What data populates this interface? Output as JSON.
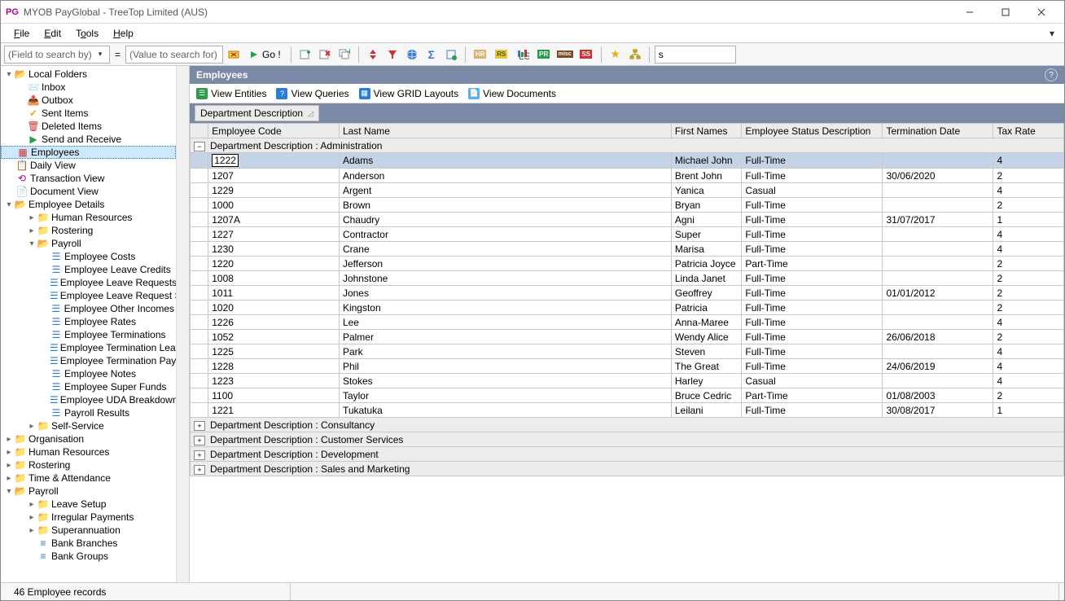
{
  "window": {
    "title": "MYOB PayGlobal - TreeTop Limited (AUS)",
    "logo": "PG"
  },
  "menu": {
    "file": "File",
    "edit": "Edit",
    "tools": "Tools",
    "help": "Help"
  },
  "toolbar": {
    "search_field_placeholder": "(Field to search by)",
    "search_value_placeholder": "(Value to search for)",
    "go_label": "Go !",
    "right_search_value": "s"
  },
  "sidebar": {
    "local_folders": {
      "label": "Local Folders",
      "inbox": "Inbox",
      "outbox": "Outbox",
      "sent": "Sent Items",
      "deleted": "Deleted Items",
      "sendrecv": "Send and Receive"
    },
    "employees": "Employees",
    "daily_view": "Daily View",
    "transaction_view": "Transaction View",
    "document_view": "Document View",
    "employee_details": {
      "label": "Employee Details",
      "hr": "Human Resources",
      "rostering": "Rostering",
      "payroll": {
        "label": "Payroll",
        "items": [
          "Employee Costs",
          "Employee Leave Credits",
          "Employee Leave Requests",
          "Employee Leave Request S",
          "Employee Other Incomes",
          "Employee Rates",
          "Employee Terminations",
          "Employee Termination Leave",
          "Employee Termination Paym",
          "Employee Notes",
          "Employee Super Funds",
          "Employee UDA Breakdowns",
          "Payroll Results"
        ]
      },
      "self_service": "Self-Service"
    },
    "organisation": "Organisation",
    "human_resources": "Human Resources",
    "rostering": "Rostering",
    "time_attendance": "Time & Attendance",
    "payroll_section": {
      "label": "Payroll",
      "items": [
        "Leave Setup",
        "Irregular Payments",
        "Superannuation",
        "Bank Branches",
        "Bank Groups"
      ]
    }
  },
  "main": {
    "title": "Employees",
    "views": {
      "entities": "View Entities",
      "queries": "View Queries",
      "grids": "View GRID Layouts",
      "docs": "View Documents"
    },
    "group_by": "Department Description",
    "columns": [
      "Employee Code",
      "Last Name",
      "First Names",
      "Employee Status Description",
      "Termination Date",
      "Tax Rate"
    ],
    "group_header_expanded": "Department Description : Administration",
    "rows": [
      {
        "code": "1222",
        "last": "Adams",
        "first": "Michael John",
        "status": "Full-Time",
        "term": "",
        "rate": "4",
        "selected": true
      },
      {
        "code": "1207",
        "last": "Anderson",
        "first": "Brent John",
        "status": "Full-Time",
        "term": "30/06/2020",
        "rate": "2"
      },
      {
        "code": "1229",
        "last": "Argent",
        "first": "Yanica",
        "status": "Casual",
        "term": "",
        "rate": "4"
      },
      {
        "code": "1000",
        "last": "Brown",
        "first": "Bryan",
        "status": "Full-Time",
        "term": "",
        "rate": "2"
      },
      {
        "code": "1207A",
        "last": "Chaudry",
        "first": "Agni",
        "status": "Full-Time",
        "term": "31/07/2017",
        "rate": "1"
      },
      {
        "code": "1227",
        "last": "Contractor",
        "first": "Super",
        "status": "Full-Time",
        "term": "",
        "rate": "4"
      },
      {
        "code": "1230",
        "last": "Crane",
        "first": "Marisa",
        "status": "Full-Time",
        "term": "",
        "rate": "4"
      },
      {
        "code": "1220",
        "last": "Jefferson",
        "first": "Patricia Joyce",
        "status": "Part-Time",
        "term": "",
        "rate": "2"
      },
      {
        "code": "1008",
        "last": "Johnstone",
        "first": "Linda Janet",
        "status": "Full-Time",
        "term": "",
        "rate": "2"
      },
      {
        "code": "1011",
        "last": "Jones",
        "first": "Geoffrey",
        "status": "Full-Time",
        "term": "01/01/2012",
        "rate": "2"
      },
      {
        "code": "1020",
        "last": "Kingston",
        "first": "Patricia",
        "status": "Full-Time",
        "term": "",
        "rate": "2"
      },
      {
        "code": "1226",
        "last": "Lee",
        "first": "Anna-Maree",
        "status": "Full-Time",
        "term": "",
        "rate": "4"
      },
      {
        "code": "1052",
        "last": "Palmer",
        "first": "Wendy Alice",
        "status": "Full-Time",
        "term": "26/06/2018",
        "rate": "2"
      },
      {
        "code": "1225",
        "last": "Park",
        "first": "Steven",
        "status": "Full-Time",
        "term": "",
        "rate": "4"
      },
      {
        "code": "1228",
        "last": "Phil",
        "first": "The Great",
        "status": "Full-Time",
        "term": "24/06/2019",
        "rate": "4"
      },
      {
        "code": "1223",
        "last": "Stokes",
        "first": "Harley",
        "status": "Casual",
        "term": "",
        "rate": "4"
      },
      {
        "code": "1100",
        "last": "Taylor",
        "first": "Bruce Cedric",
        "status": "Part-Time",
        "term": "01/08/2003",
        "rate": "2"
      },
      {
        "code": "1221",
        "last": "Tukatuka",
        "first": "Leilani",
        "status": "Full-Time",
        "term": "30/08/2017",
        "rate": "1"
      }
    ],
    "collapsed_groups": [
      "Department Description : Consultancy",
      "Department Description : Customer Services",
      "Department Description : Development",
      "Department Description : Sales and Marketing"
    ]
  },
  "statusbar": {
    "text": "46 Employee records"
  }
}
